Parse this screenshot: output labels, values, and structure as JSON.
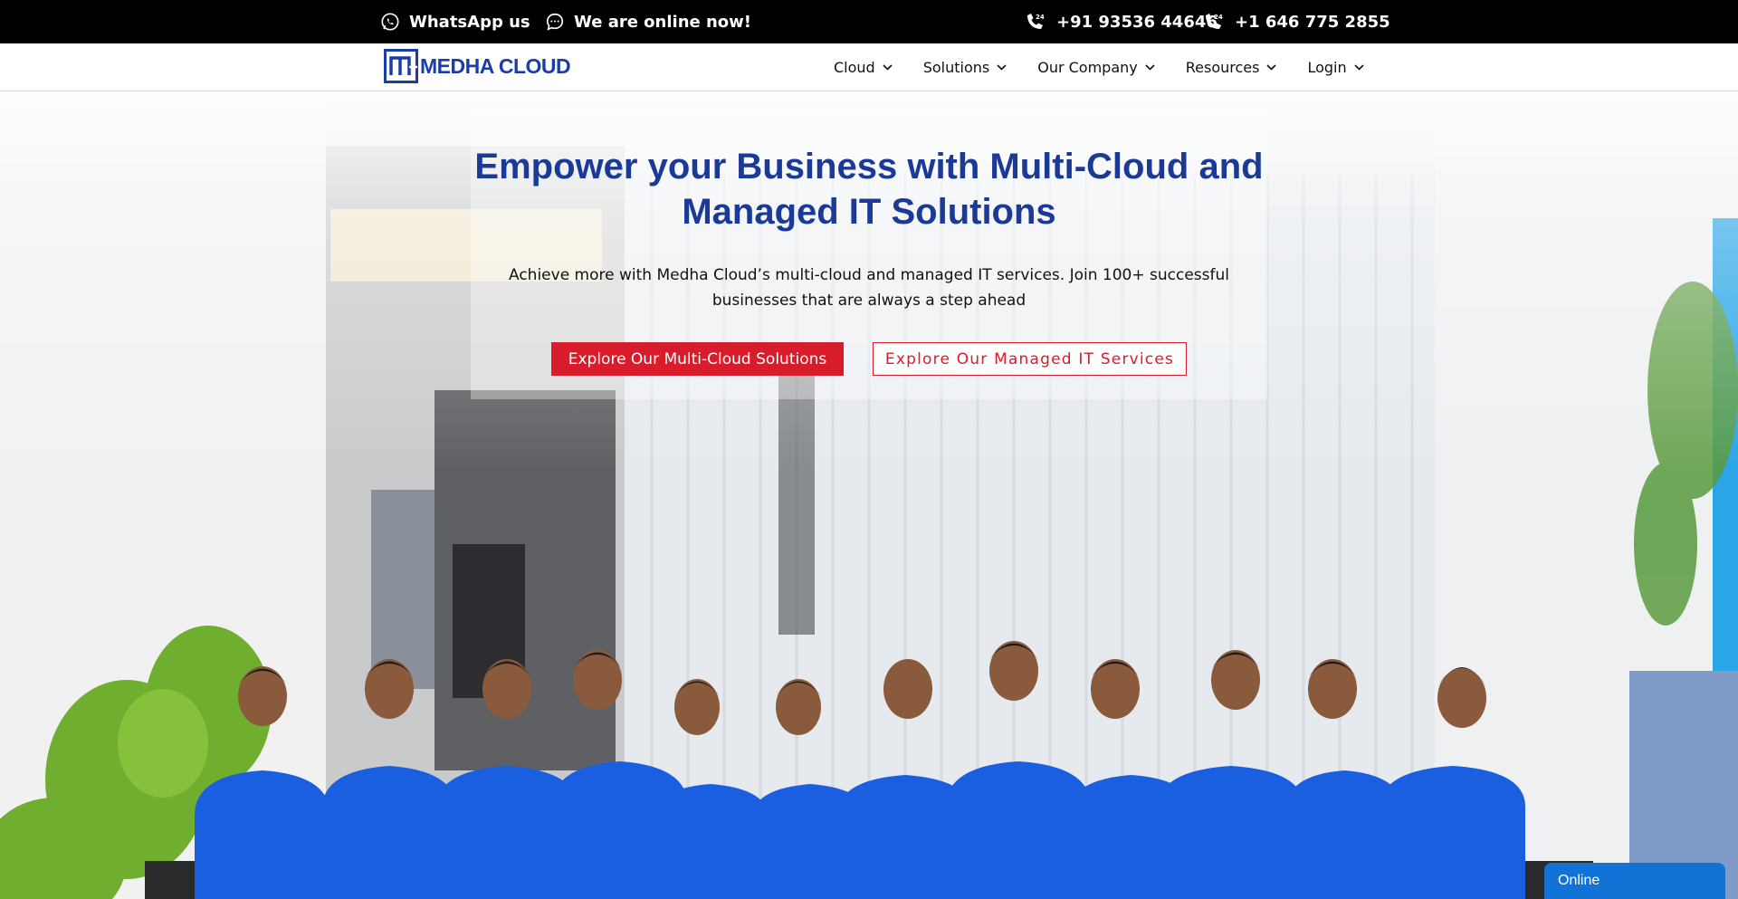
{
  "topbar": {
    "whatsapp_label": "WhatsApp us",
    "online_label": "We are online now!",
    "phone_india": "+91 93536 44646",
    "phone_us": "+1 646 775 2855",
    "icons": [
      "whatsapp-icon",
      "chat-bubble-icon",
      "phone-24-icon",
      "phone-24-icon"
    ]
  },
  "nav": {
    "logo_text": "MEDHA CLOUD",
    "items": [
      {
        "label": "Cloud"
      },
      {
        "label": "Solutions"
      },
      {
        "label": "Our Company"
      },
      {
        "label": "Resources"
      },
      {
        "label": "Login"
      }
    ]
  },
  "hero": {
    "title": "Empower your Business with Multi-Cloud and Managed IT Solutions",
    "subtitle": "Achieve more with Medha Cloud’s multi-cloud and managed IT services. Join 100+ successful businesses that are always a step ahead",
    "primary_button": "Explore Our Multi-Cloud Solutions",
    "secondary_button": "Explore Our Managed IT Services"
  },
  "chat": {
    "status_label": "Online"
  },
  "colors": {
    "brand_blue": "#1b3996",
    "accent_red": "#d91c2b",
    "topbar_bg": "#000000",
    "chat_blue": "#1273d6",
    "shirt_blue": "#1a5fe0"
  }
}
